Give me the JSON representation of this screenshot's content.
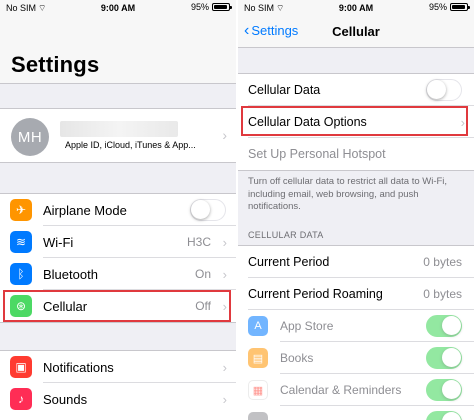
{
  "colors": {
    "accent": "#007aff",
    "highlight": "#e0393e",
    "toggle_on": "#4cd964"
  },
  "left": {
    "status": {
      "carrier": "No SIM",
      "time": "9:00 AM",
      "battery": "95%"
    },
    "title": "Settings",
    "profile": {
      "initials": "MH",
      "subtitle": "Apple ID, iCloud, iTunes & App..."
    },
    "rows": [
      {
        "label": "Airplane Mode",
        "icon": "airplane-icon",
        "toggle": false
      },
      {
        "label": "Wi-Fi",
        "icon": "wifi-icon",
        "value": "H3C"
      },
      {
        "label": "Bluetooth",
        "icon": "bluetooth-icon",
        "value": "On"
      },
      {
        "label": "Cellular",
        "icon": "cellular-antenna-icon",
        "value": "Off"
      }
    ],
    "rows2": [
      {
        "label": "Notifications",
        "icon": "notifications-icon"
      },
      {
        "label": "Sounds",
        "icon": "sounds-icon"
      }
    ]
  },
  "right": {
    "status": {
      "carrier": "No SIM",
      "time": "9:00 AM",
      "battery": "95%"
    },
    "nav": {
      "back": "Settings",
      "title": "Cellular"
    },
    "cellular_data": {
      "label": "Cellular Data",
      "toggle": false
    },
    "options_label": "Cellular Data Options",
    "hotspot_label": "Set Up Personal Hotspot",
    "footer": "Turn off cellular data to restrict all data to Wi-Fi, including email, web browsing, and push notifications.",
    "section_header": "CELLULAR DATA",
    "current_period": {
      "label": "Current Period",
      "value": "0 bytes"
    },
    "roaming": {
      "label": "Current Period Roaming",
      "value": "0 bytes"
    },
    "apps": [
      {
        "label": "App Store",
        "icon": "app-store-icon",
        "toggle": true
      },
      {
        "label": "Books",
        "icon": "books-icon",
        "toggle": true
      },
      {
        "label": "Calendar & Reminders",
        "icon": "calendar-icon",
        "toggle": true
      },
      {
        "label": "",
        "icon": "app-icon",
        "toggle": true
      }
    ]
  }
}
